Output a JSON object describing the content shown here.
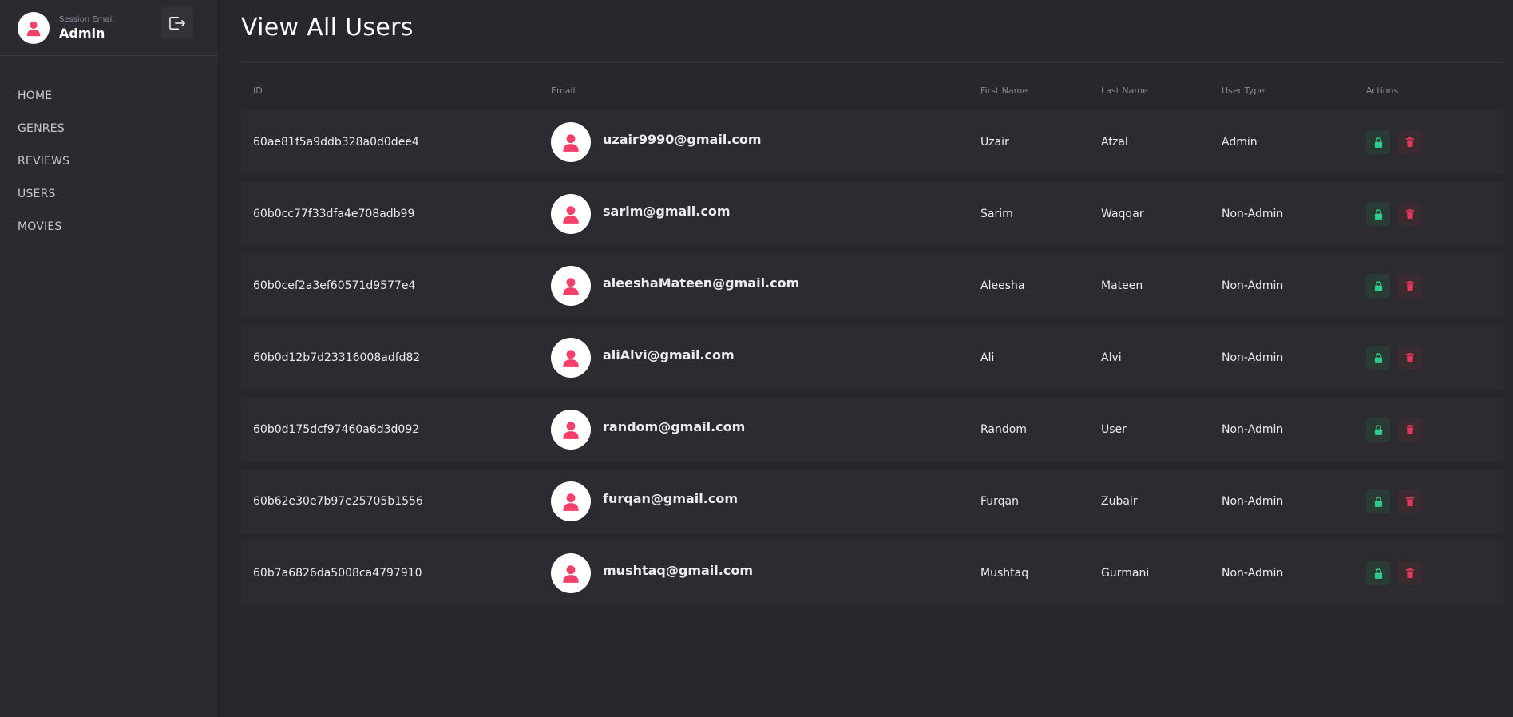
{
  "colors": {
    "lock": "#2ecc8f",
    "delete": "#e4375c",
    "avatar": "#f43f68"
  },
  "session": {
    "label": "Session Email",
    "name": "Admin",
    "logout_icon": "logout-icon"
  },
  "nav": [
    "HOME",
    "GENRES",
    "REVIEWS",
    "USERS",
    "MOVIES"
  ],
  "page": {
    "title": "View All Users"
  },
  "table": {
    "headers": {
      "id": "ID",
      "email": "Email",
      "first": "First Name",
      "last": "Last Name",
      "type": "User Type",
      "actions": "Actions"
    },
    "rows": [
      {
        "id": "60ae81f5a9ddb328a0d0dee4",
        "email": "uzair9990@gmail.com",
        "first": "Uzair",
        "last": "Afzal",
        "type": "Admin"
      },
      {
        "id": "60b0cc77f33dfa4e708adb99",
        "email": "sarim@gmail.com",
        "first": "Sarim",
        "last": "Waqqar",
        "type": "Non-Admin"
      },
      {
        "id": "60b0cef2a3ef60571d9577e4",
        "email": "aleeshaMateen@gmail.com",
        "first": "Aleesha",
        "last": "Mateen",
        "type": "Non-Admin"
      },
      {
        "id": "60b0d12b7d23316008adfd82",
        "email": "aliAlvi@gmail.com",
        "first": "Ali",
        "last": "Alvi",
        "type": "Non-Admin"
      },
      {
        "id": "60b0d175dcf97460a6d3d092",
        "email": "random@gmail.com",
        "first": "Random",
        "last": "User",
        "type": "Non-Admin"
      },
      {
        "id": "60b62e30e7b97e25705b1556",
        "email": "furqan@gmail.com",
        "first": "Furqan",
        "last": "Zubair",
        "type": "Non-Admin"
      },
      {
        "id": "60b7a6826da5008ca4797910",
        "email": "mushtaq@gmail.com",
        "first": "Mushtaq",
        "last": "Gurmani",
        "type": "Non-Admin"
      }
    ]
  }
}
